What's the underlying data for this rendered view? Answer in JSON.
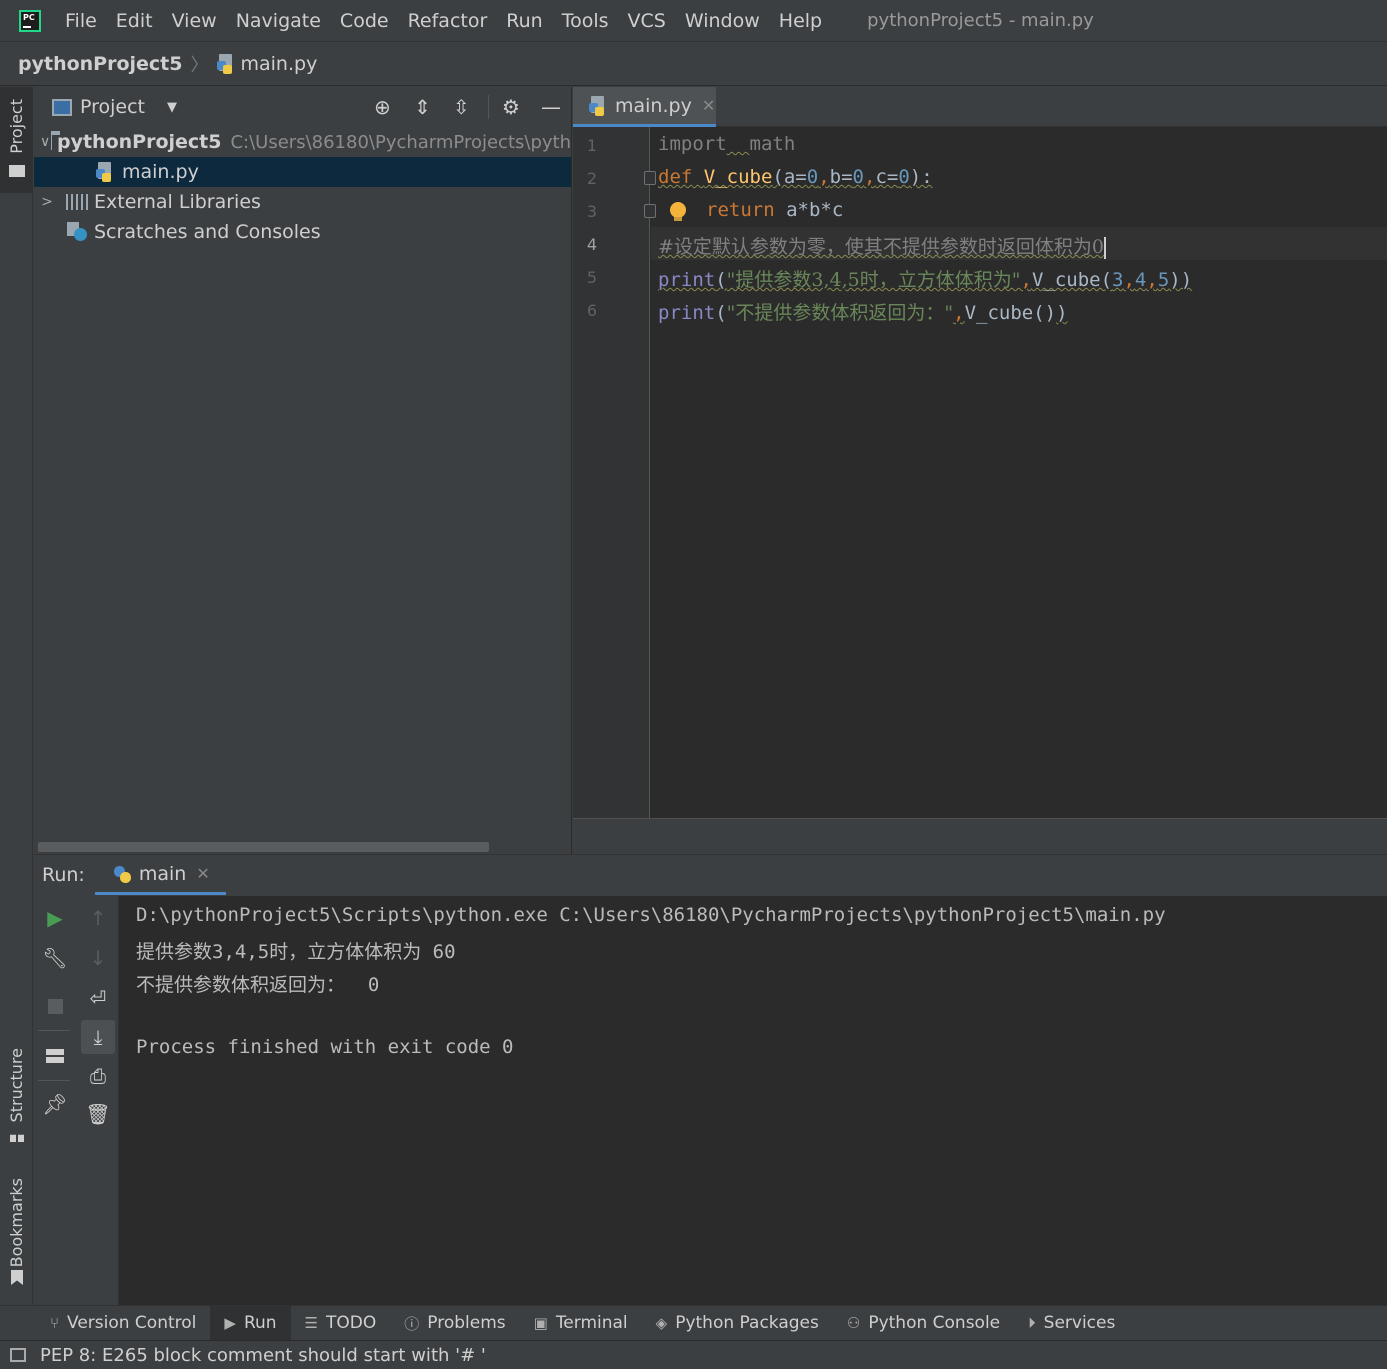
{
  "menubar": {
    "items": [
      "File",
      "Edit",
      "View",
      "Navigate",
      "Code",
      "Refactor",
      "Run",
      "Tools",
      "VCS",
      "Window",
      "Help"
    ],
    "window_title": "pythonProject5 - main.py"
  },
  "breadcrumb": {
    "project": "pythonProject5",
    "file": "main.py"
  },
  "left_stripe": {
    "project": "Project",
    "structure": "Structure",
    "bookmarks": "Bookmarks"
  },
  "project_panel": {
    "title": "Project",
    "tree": {
      "root_name": "pythonProject5",
      "root_path": "C:\\Users\\86180\\PycharmProjects\\pyth",
      "file": "main.py",
      "external_libraries": "External Libraries",
      "scratches": "Scratches and Consoles"
    }
  },
  "editor": {
    "tab_label": "main.py",
    "line_numbers": [
      "1",
      "2",
      "3",
      "4",
      "5",
      "6"
    ],
    "code": {
      "l1_import": "import",
      "l1_sp": "  ",
      "l1_mod": "math",
      "l2_def": "def",
      "l2_fn": "V_cube",
      "l2_open": "(a=",
      "l2_a": "0",
      "l2_c1": ",",
      "l2_b": "b=",
      "l2_bv": "0",
      "l2_c2": ",",
      "l2_c": "c=",
      "l2_cv": "0",
      "l2_close": "):",
      "l3_return": "return",
      "l3_expr": " a*b*c",
      "l4_comment": "#设定默认参数为零，使其不提供参数时返回体积为0",
      "l5_print": "print",
      "l5_open": "(",
      "l5_str": "\"提供参数3,4,5时，立方体体积为\"",
      "l5_comma": ",",
      "l5_fn": "V_cube(",
      "l5_n1": "3",
      "l5_k1": ",",
      "l5_n2": "4",
      "l5_k2": ",",
      "l5_n3": "5",
      "l5_end": "))",
      "l6_print": "print",
      "l6_open": "(",
      "l6_str": "\"不提供参数体积返回为：\"",
      "l6_comma": ",",
      "l6_fn": "V_cube()",
      "l6_end": ")"
    }
  },
  "run_panel": {
    "label": "Run:",
    "tab_label": "main",
    "console": [
      "D:\\pythonProject5\\Scripts\\python.exe C:\\Users\\86180\\PycharmProjects\\pythonProject5\\main.py",
      "提供参数3,4,5时，立方体体积为 60",
      "不提供参数体积返回为：  0",
      "",
      "Process finished with exit code 0"
    ]
  },
  "tool_windows": [
    {
      "label": "Version Control",
      "icon": "branch-icon"
    },
    {
      "label": "Run",
      "icon": "play-icon"
    },
    {
      "label": "TODO",
      "icon": "list-icon"
    },
    {
      "label": "Problems",
      "icon": "info-icon"
    },
    {
      "label": "Terminal",
      "icon": "terminal-icon"
    },
    {
      "label": "Python Packages",
      "icon": "layers-icon"
    },
    {
      "label": "Python Console",
      "icon": "python-icon"
    },
    {
      "label": "Services",
      "icon": "services-icon"
    }
  ],
  "status": {
    "message": "PEP 8: E265 block comment should start with '# '"
  },
  "colors": {
    "keyword": "#cc7832",
    "function": "#ffc66d",
    "number": "#6897bb",
    "string": "#6a8759",
    "comment": "#808080",
    "builtin": "#8888c6",
    "run_green": "#499c54",
    "selection": "#0d293e"
  }
}
